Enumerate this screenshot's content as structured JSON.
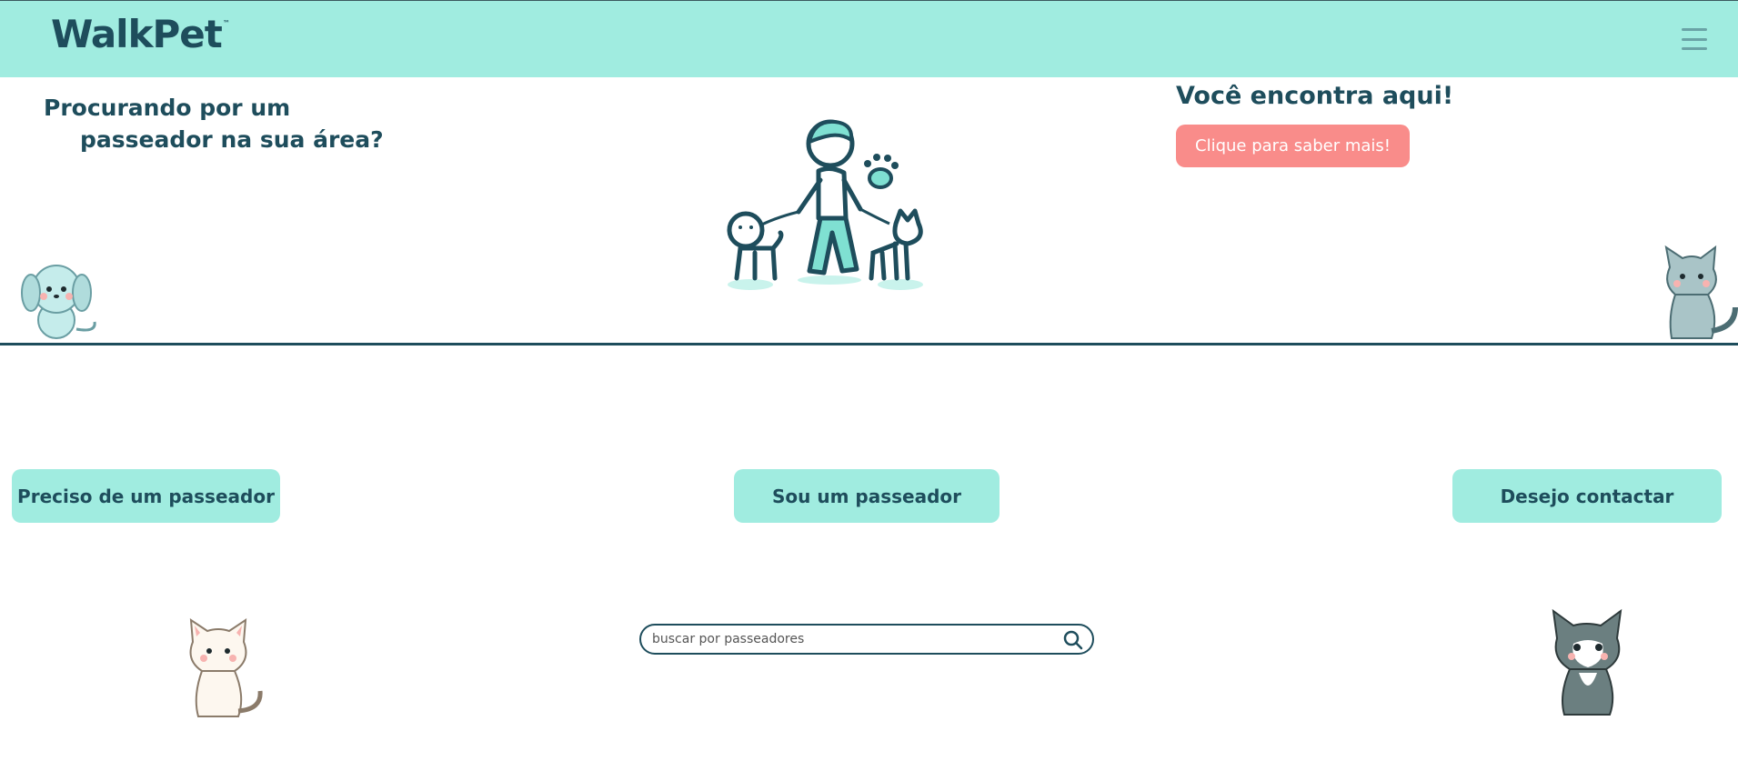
{
  "header": {
    "logo_text": "WalkPet",
    "logo_mark": "™",
    "menu_icon": "hamburger-menu-icon"
  },
  "hero": {
    "question_line1": "Procurando por um",
    "question_line2": "passeador na sua área?",
    "right_title": "Você encontra aqui!",
    "cta_label": "Clique para saber mais!"
  },
  "nav": {
    "need_walker": "Preciso de um passeador",
    "am_walker": "Sou um passeador",
    "contact": "Desejo contactar"
  },
  "search": {
    "placeholder": "buscar por passeadores",
    "icon": "search-icon"
  },
  "colors": {
    "accent": "#a0ece0",
    "primary_text": "#1e4d5c",
    "cta": "#f98c8a"
  }
}
